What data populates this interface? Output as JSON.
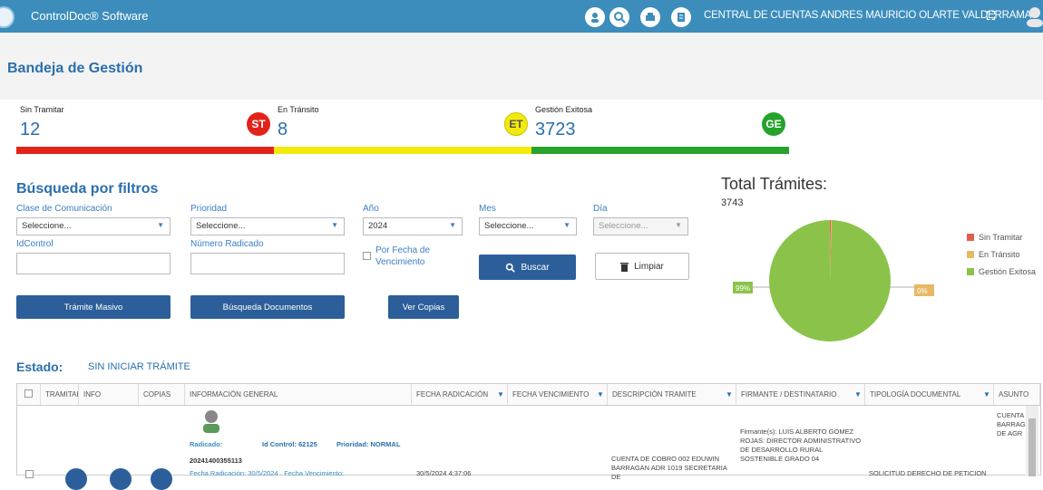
{
  "app": {
    "title": "ControlDoc® Software",
    "user": "CENTRAL DE CUENTAS ANDRES MAURICIO OLARTE VALDERRAMA",
    "icons": [
      "user-badge-icon",
      "search-icon",
      "printer-icon",
      "document-icon"
    ]
  },
  "page": {
    "title": "Bandeja de Gestión"
  },
  "cards": [
    {
      "label": "Sin Tramitar",
      "value": "12",
      "badge": "ST",
      "color": "#e2231a"
    },
    {
      "label": "En Tránsito",
      "value": "8",
      "badge": "ET",
      "color": "#f2ea0c"
    },
    {
      "label": "Gestión Exitosa",
      "value": "3723",
      "badge": "GE",
      "color": "#27a22d"
    }
  ],
  "filters": {
    "title": "Búsqueda por filtros",
    "clase_label": "Clase de Comunicación",
    "clase_value": "Seleccione...",
    "prioridad_label": "Prioridad",
    "prioridad_value": "Seleccione...",
    "anio_label": "Año",
    "anio_value": "2024",
    "mes_label": "Mes",
    "mes_value": "Seleccione...",
    "dia_label": "Día",
    "dia_value": "Seleccione...",
    "idcontrol_label": "IdControl",
    "radicado_label": "Número Radicado",
    "vencimiento_label": "Por Fecha de Vencimiento",
    "buscar_label": "Buscar",
    "limpiar_label": "Limpiar",
    "masivo_label": "Trámite Masivo",
    "documentos_label": "Búsqueda Documentos",
    "copias_label": "Ver Copias"
  },
  "chart_data": {
    "type": "pie",
    "title": "Total Trámites:",
    "subtitle": "3743",
    "categories": [
      "Sin Tramitar",
      "En Tránsito",
      "Gestión Exitosa"
    ],
    "values": [
      12,
      8,
      3723
    ],
    "colors": [
      "#e35b4f",
      "#e8b866",
      "#8bc34a"
    ],
    "data_labels": [
      "",
      "0%",
      "99%"
    ],
    "legend": "right"
  },
  "estado": {
    "label": "Estado:",
    "value": "SIN INICIAR TRÁMITE"
  },
  "table": {
    "headers": [
      "TRAMITAR",
      "INFO",
      "COPIAS",
      "INFORMACIÓN GENERAL",
      "FECHA RADICACIÓN",
      "FECHA VENCIMIENTO",
      "DESCRIPCIÓN TRAMITE",
      "FIRMANTE / DESTINATARIO",
      "TIPOLOGÍA DOCUMENTAL",
      "ASUNTO"
    ],
    "row": {
      "radicado_label": "Radicado:",
      "id_control": "Id Control: 62125",
      "prioridad": "Prioridad: NORMAL",
      "radicado_num": "20241400355113",
      "fecha_line": "Fecha Radicación: 30/5/2024 · Fecha Vencimiento:",
      "fecha_radicacion": "30/5/2024 4:37:06",
      "descripcion": "CUENTA DE COBRO 002 EDUWIN BARRAGAN ADR 1019 SECRETARIA DE",
      "firmante": "Firmante(s): LUIS ALBERTO GOMEZ ROJAS: DIRECTOR ADMINISTRATIVO DE DESARROLLO RURAL SOSTENIBLE GRADO 04",
      "tipologia": "SOLICITUD DERECHO DE PETICION",
      "asunto": "CUENTA BARRAG DE AGR"
    }
  }
}
